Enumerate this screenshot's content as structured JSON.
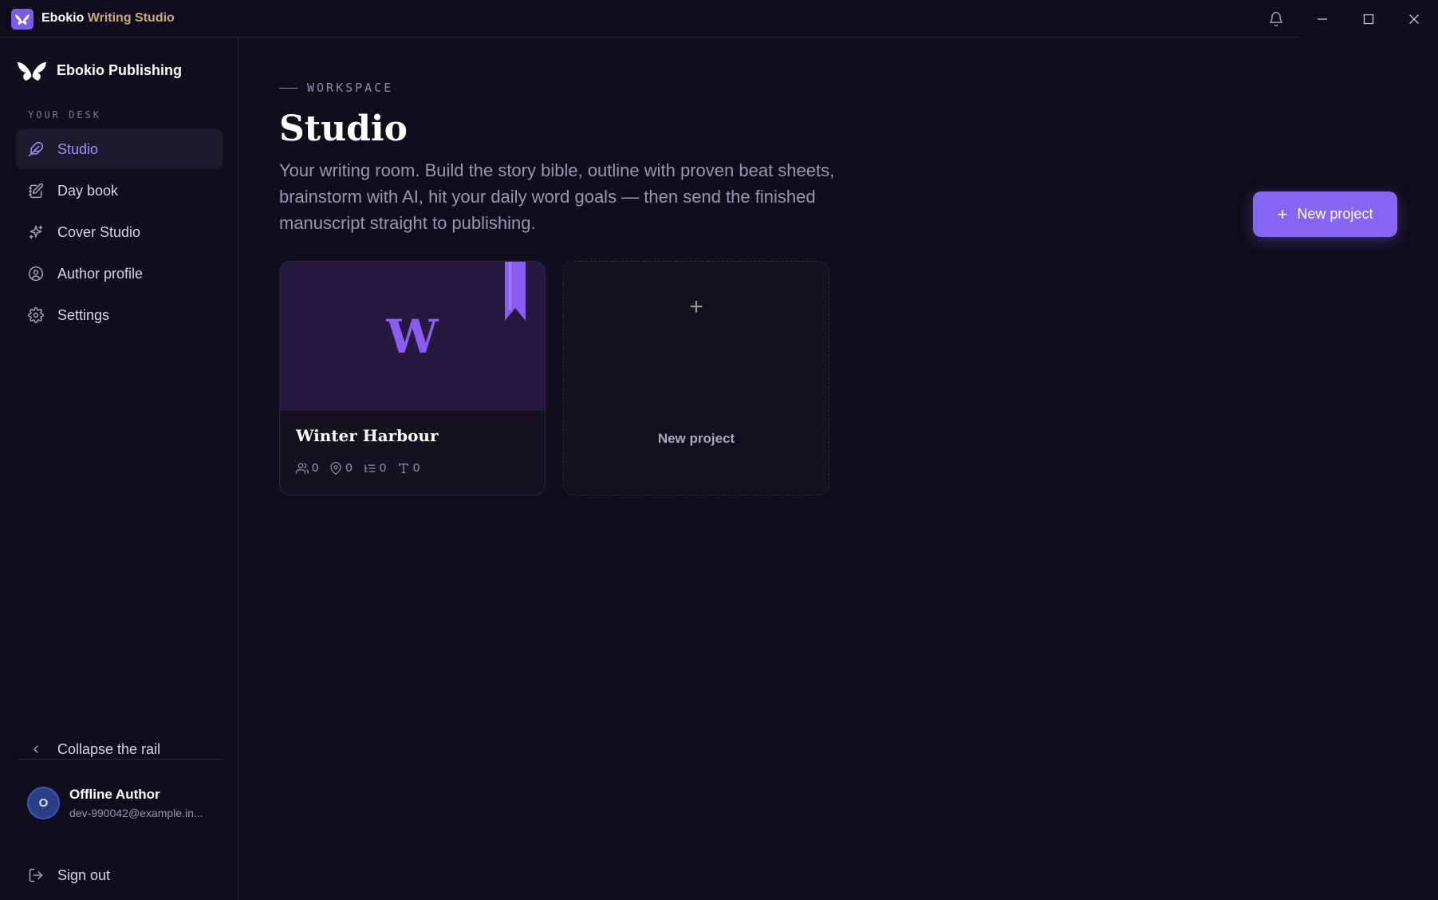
{
  "window": {
    "title_brand": "Ebokio",
    "title_rest": " Writing Studio"
  },
  "sidebar": {
    "brand_name": "Ebokio Publishing",
    "section_label": "YOUR DESK",
    "items": [
      {
        "label": "Studio",
        "icon": "feather-icon",
        "active": true
      },
      {
        "label": "Day book",
        "icon": "notebook-edit-icon",
        "active": false
      },
      {
        "label": "Cover Studio",
        "icon": "sparkles-icon",
        "active": false
      },
      {
        "label": "Author profile",
        "icon": "user-circle-icon",
        "active": false
      },
      {
        "label": "Settings",
        "icon": "gear-icon",
        "active": false
      }
    ],
    "collapse_label": "Collapse the rail",
    "user": {
      "initial": "O",
      "name": "Offline Author",
      "email": "dev-990042@example.in..."
    },
    "signout_label": "Sign out"
  },
  "main": {
    "eyebrow": "WORKSPACE",
    "title": "Studio",
    "description": "Your writing room. Build the story bible, outline with proven beat sheets, brainstorm with AI, hit your daily word goals — then send the finished manuscript straight to publishing.",
    "new_project_button": "New project",
    "projects": [
      {
        "cover_letter": "W",
        "title": "Winter Harbour",
        "stats": {
          "characters": "0",
          "locations": "0",
          "outline": "0",
          "words": "0"
        }
      }
    ],
    "new_project_card_label": "New project",
    "new_project_card_plus": "+"
  },
  "colors": {
    "background": "#100d1c",
    "accent": "#8466f0",
    "active_nav_text": "#a68bff",
    "title_accent": "#c9a97a"
  }
}
